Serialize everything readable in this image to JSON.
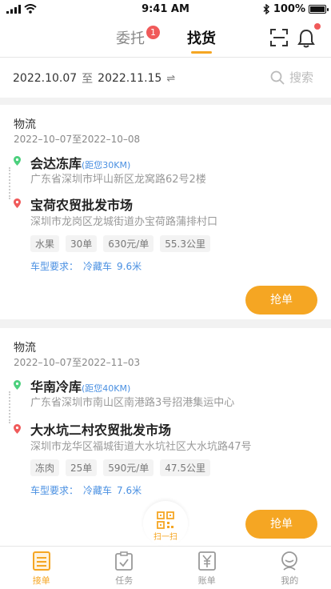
{
  "status_bar": {
    "time": "9:41 AM",
    "battery": "100%",
    "battery_level": 1.0
  },
  "header": {
    "tabs": [
      {
        "label": "委托",
        "badge": "1"
      },
      {
        "label": "找货"
      }
    ],
    "icons": [
      "scan-icon",
      "bell-icon"
    ]
  },
  "filter": {
    "start_date": "2022.10.07",
    "to_label": "至",
    "end_date": "2022.11.15",
    "swap_icon": "⇌",
    "search_label": "搜索"
  },
  "orders": [
    {
      "category": "物流",
      "date_range": "2022–10–07至2022–10–08",
      "origin": {
        "name": "会达冻库",
        "distance": "(距您30KM)",
        "address": "广东省深圳市坪山新区龙窝路62号2楼"
      },
      "destination": {
        "name": "宝荷农贸批发市场",
        "address": "深圳市龙岗区龙城街道办宝荷路蒲排村口"
      },
      "tags": [
        "水果",
        "30单",
        "630元/单",
        "55.3公里"
      ],
      "vehicle_label": "车型要求：",
      "vehicle_type": "冷藏车",
      "vehicle_length": "9.6米",
      "button": "抢单"
    },
    {
      "category": "物流",
      "date_range": "2022–10–07至2022–11–03",
      "origin": {
        "name": "华南冷库",
        "distance": "(距您40KM)",
        "address": "广东省深圳市南山区南港路3号招港集运中心"
      },
      "destination": {
        "name": "大水坑二村农贸批发市场",
        "address": "深圳市龙华区福城街道大水坑社区大水坑路47号"
      },
      "tags": [
        "冻肉",
        "25单",
        "590元/单",
        "47.5公里"
      ],
      "vehicle_label": "车型要求：",
      "vehicle_type": "冷藏车",
      "vehicle_length": "7.6米",
      "button": "抢单"
    }
  ],
  "fab": {
    "label": "扫一扫",
    "icon": "qr-code-icon"
  },
  "bottom_nav": [
    {
      "label": "接单",
      "icon": "order-list-icon",
      "active": true
    },
    {
      "label": "任务",
      "icon": "clipboard-check-icon"
    },
    {
      "label": "账单",
      "icon": "yen-bill-icon"
    },
    {
      "label": "我的",
      "icon": "profile-icon"
    }
  ],
  "colors": {
    "accent": "#f5a623",
    "badge": "#f05a5a",
    "link": "#4a90e2"
  }
}
